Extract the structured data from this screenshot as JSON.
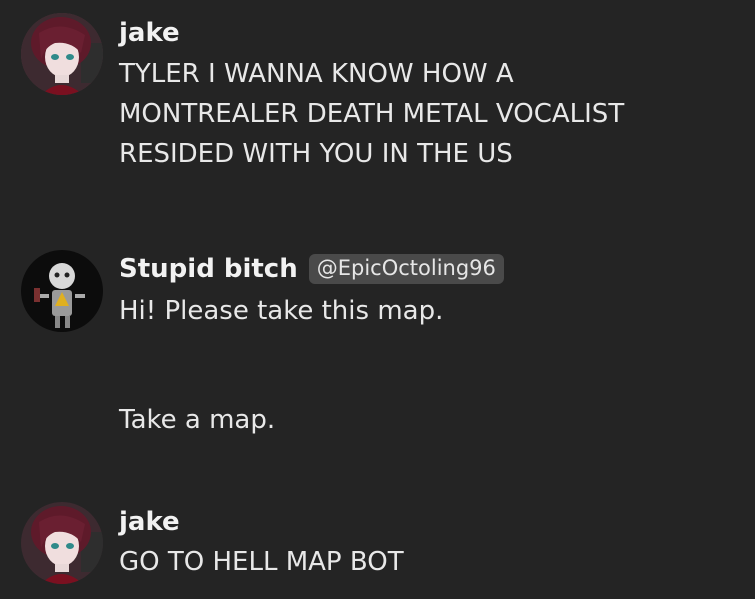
{
  "messages": [
    {
      "author": "jake",
      "avatar_icon": "anime-character-avatar-icon",
      "lines": [
        "TYLER I WANNA KNOW HOW A",
        "MONTREALER DEATH METAL VOCALIST",
        "RESIDED WITH YOU IN THE US"
      ]
    },
    {
      "author": "Stupid bitch",
      "handle": "@EpicOctoling96",
      "avatar_icon": "robot-avatar-icon",
      "lines": [
        "Hi! Please take this map.",
        "Take a map."
      ]
    },
    {
      "author": "jake",
      "avatar_icon": "anime-character-avatar-icon",
      "lines": [
        "GO TO HELL MAP BOT"
      ]
    }
  ],
  "colors": {
    "background": "#242424",
    "text": "#e8e8e8",
    "handle_badge": "#4a4a4a"
  }
}
